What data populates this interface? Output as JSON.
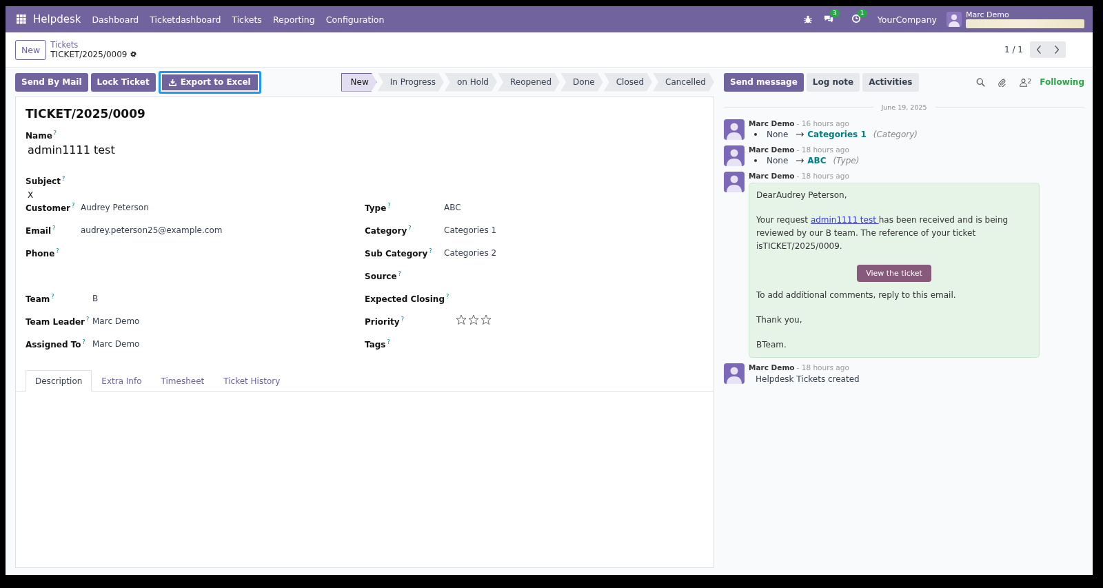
{
  "navbar": {
    "app": "Helpdesk",
    "menu": [
      "Dashboard",
      "Ticketdashboard",
      "Tickets",
      "Reporting",
      "Configuration"
    ],
    "messages_badge": "3",
    "activities_badge": "1",
    "company": "YourCompany",
    "user": "Marc Demo"
  },
  "control_panel": {
    "new_button": "New",
    "breadcrumb": "Tickets",
    "record": "TICKET/2025/0009",
    "pager": "1 / 1"
  },
  "actions": [
    {
      "label": "Send By Mail",
      "focused": false,
      "kind": "plain"
    },
    {
      "label": "Lock Ticket",
      "focused": false,
      "kind": "plain"
    },
    {
      "label": "Export to Excel",
      "focused": true,
      "kind": "export"
    }
  ],
  "stages": [
    {
      "label": "New",
      "selected": true
    },
    {
      "label": "In Progress",
      "selected": false
    },
    {
      "label": "on Hold",
      "selected": false
    },
    {
      "label": "Reopened",
      "selected": false
    },
    {
      "label": "Done",
      "selected": false
    },
    {
      "label": "Closed",
      "selected": false
    },
    {
      "label": "Cancelled",
      "selected": false
    }
  ],
  "form": {
    "title": "TICKET/2025/0009",
    "name_label": "Name",
    "name_help": "?",
    "name": "admin1111 test",
    "subject_label": "Subject",
    "subject_help": "?",
    "subject": "X",
    "left_fields": [
      {
        "label": "Customer",
        "help": "?",
        "value": "Audrey Peterson"
      },
      {
        "label": "Email",
        "help": "?",
        "value": "audrey.peterson25@example.com"
      },
      {
        "label": "Phone",
        "help": "?"
      },
      {
        "label": "Team",
        "help": "?",
        "value": "B"
      },
      {
        "label": "Team Leader",
        "help": "?",
        "value": "Marc Demo"
      },
      {
        "label": "Assigned To",
        "help": "?",
        "value": "Marc Demo"
      }
    ],
    "right_fields": [
      {
        "label": "Type",
        "help": "?",
        "value": "ABC",
        "kind": "text"
      },
      {
        "label": "Category",
        "help": "?",
        "value": "Categories 1",
        "kind": "text"
      },
      {
        "label": "Sub Category",
        "help": "?",
        "value": "Categories 2",
        "kind": "text"
      },
      {
        "label": "Source",
        "help": "?",
        "kind": "text"
      },
      {
        "label": "Expected Closing",
        "help": "?",
        "kind": "text"
      },
      {
        "label": "Priority",
        "help": "?",
        "stars": 0,
        "kind": "stars"
      },
      {
        "label": "Tags",
        "help": "?",
        "kind": "text"
      }
    ],
    "tabs": [
      {
        "label": "Description",
        "selected": true
      },
      {
        "label": "Extra Info",
        "selected": false
      },
      {
        "label": "Timesheet",
        "selected": false
      },
      {
        "label": "Ticket History",
        "selected": false
      }
    ]
  },
  "chatter": {
    "buttons": [
      {
        "label": "Send message",
        "selected": true
      },
      {
        "label": "Log note",
        "selected": false
      },
      {
        "label": "Activities",
        "selected": false
      }
    ],
    "followers": "2",
    "following": "Following",
    "date": "June 19, 2025",
    "messages": [
      {
        "kind": "tracking",
        "author": "Marc Demo",
        "time": "- 16 hours ago",
        "old": "None",
        "new": "Categories 1",
        "field": "(Category)"
      },
      {
        "kind": "tracking",
        "author": "Marc Demo",
        "time": "- 18 hours ago",
        "old": "None",
        "new": "ABC",
        "field": "(Type)"
      },
      {
        "kind": "email",
        "author": "Marc Demo",
        "time": "- 18 hours ago",
        "greeting": "DearAudrey Peterson,",
        "pre": "Your request ",
        "link": "admin1111 test ",
        "post": "has been received and is being reviewed by our B team. The reference of your ticket isTICKET/2025/0009.",
        "button": "View the ticket",
        "lines": [
          "To add additional comments, reply to this email.",
          "Thank you,",
          "BTeam."
        ]
      },
      {
        "kind": "note",
        "author": "Marc Demo",
        "time": "- 18 hours ago",
        "text": "Helpdesk Tickets created"
      }
    ]
  }
}
